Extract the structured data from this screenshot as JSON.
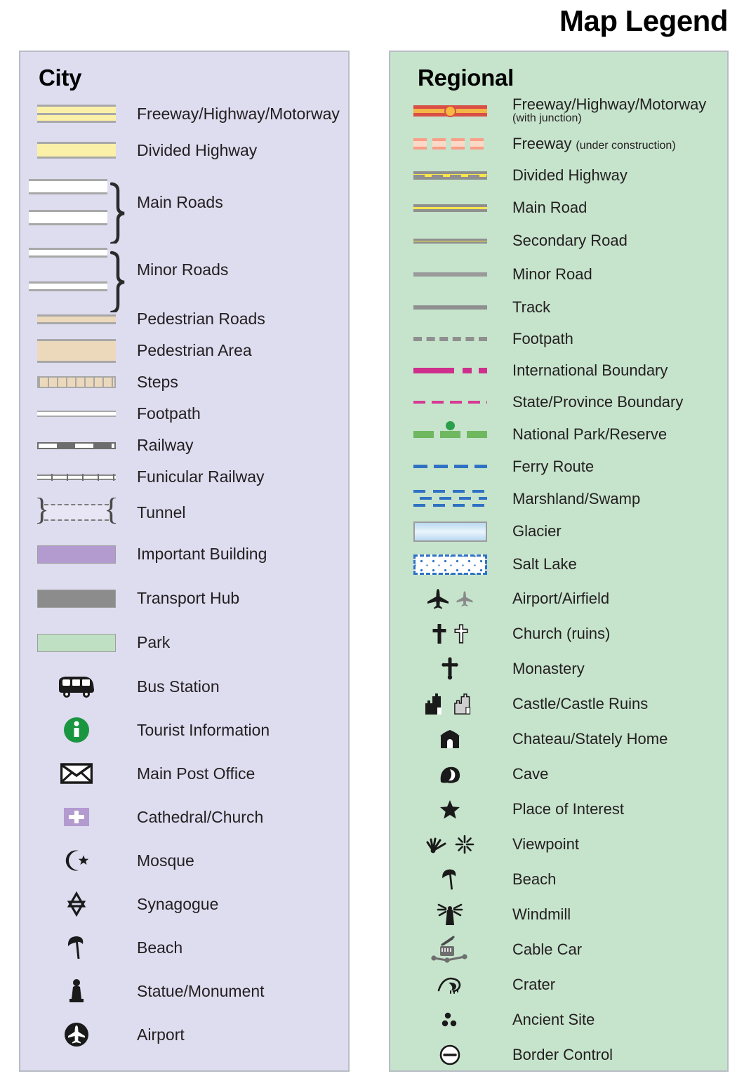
{
  "title": "Map Legend",
  "city": {
    "heading": "City",
    "items": [
      {
        "label": "Freeway/Highway/Motorway",
        "symbol": "freeway-band"
      },
      {
        "label": "Divided Highway",
        "symbol": "divided-highway-band"
      },
      {
        "label": "Main Roads",
        "symbol": "main-roads-bracket"
      },
      {
        "label": "Minor Roads",
        "symbol": "minor-roads-bracket"
      },
      {
        "label": "Pedestrian Roads",
        "symbol": "pedestrian-road-band"
      },
      {
        "label": "Pedestrian Area",
        "symbol": "pedestrian-area-block"
      },
      {
        "label": "Steps",
        "symbol": "steps-band"
      },
      {
        "label": "Footpath",
        "symbol": "footpath-band"
      },
      {
        "label": "Railway",
        "symbol": "railway-band"
      },
      {
        "label": "Funicular Railway",
        "symbol": "funicular-railway-band"
      },
      {
        "label": "Tunnel",
        "symbol": "tunnel-band"
      },
      {
        "label": "Important Building",
        "symbol": "important-building-block"
      },
      {
        "label": "Transport Hub",
        "symbol": "transport-hub-block"
      },
      {
        "label": "Park",
        "symbol": "park-block"
      },
      {
        "label": "Bus Station",
        "symbol": "bus-icon"
      },
      {
        "label": "Tourist Information",
        "symbol": "information-icon"
      },
      {
        "label": "Main Post Office",
        "symbol": "envelope-icon"
      },
      {
        "label": "Cathedral/Church",
        "symbol": "church-cross-icon"
      },
      {
        "label": "Mosque",
        "symbol": "crescent-star-icon"
      },
      {
        "label": "Synagogue",
        "symbol": "star-of-david-icon"
      },
      {
        "label": "Beach",
        "symbol": "beach-umbrella-icon"
      },
      {
        "label": "Statue/Monument",
        "symbol": "statue-icon"
      },
      {
        "label": "Airport",
        "symbol": "airplane-circle-icon"
      }
    ]
  },
  "regional": {
    "heading": "Regional",
    "items": [
      {
        "label": "Freeway/Highway/Motorway",
        "sublabel": "(with junction)",
        "symbol": "freeway-junction-line"
      },
      {
        "label": "Freeway",
        "sublabel": "(under construction)",
        "symbol": "freeway-under-construction-line"
      },
      {
        "label": "Divided Highway",
        "symbol": "divided-highway-line"
      },
      {
        "label": "Main Road",
        "symbol": "main-road-line"
      },
      {
        "label": "Secondary Road",
        "symbol": "secondary-road-line"
      },
      {
        "label": "Minor Road",
        "symbol": "minor-road-line"
      },
      {
        "label": "Track",
        "symbol": "track-line"
      },
      {
        "label": "Footpath",
        "symbol": "footpath-dashed-line"
      },
      {
        "label": "International Boundary",
        "symbol": "international-boundary-line"
      },
      {
        "label": "State/Province Boundary",
        "symbol": "state-boundary-line"
      },
      {
        "label": "National Park/Reserve",
        "symbol": "national-park-line"
      },
      {
        "label": "Ferry Route",
        "symbol": "ferry-route-line"
      },
      {
        "label": "Marshland/Swamp",
        "symbol": "marshland-pattern"
      },
      {
        "label": "Glacier",
        "symbol": "glacier-swatch"
      },
      {
        "label": "Salt Lake",
        "symbol": "salt-lake-swatch"
      },
      {
        "label": "Airport/Airfield",
        "symbol": "airplane-pair-icon"
      },
      {
        "label": "Church (ruins)",
        "symbol": "cross-pair-icon"
      },
      {
        "label": "Monastery",
        "symbol": "monastery-cross-icon"
      },
      {
        "label": "Castle/Castle Ruins",
        "symbol": "castle-pair-icon"
      },
      {
        "label": "Chateau/Stately Home",
        "symbol": "chateau-icon"
      },
      {
        "label": "Cave",
        "symbol": "cave-icon"
      },
      {
        "label": "Place of Interest",
        "symbol": "star-icon"
      },
      {
        "label": "Viewpoint",
        "symbol": "viewpoint-pair-icon"
      },
      {
        "label": "Beach",
        "symbol": "beach-umbrella-icon"
      },
      {
        "label": "Windmill",
        "symbol": "windmill-icon"
      },
      {
        "label": "Cable Car",
        "symbol": "cable-car-icon"
      },
      {
        "label": "Crater",
        "symbol": "crater-icon"
      },
      {
        "label": "Ancient Site",
        "symbol": "ancient-site-icon"
      },
      {
        "label": "Border Control",
        "symbol": "border-control-icon"
      }
    ]
  },
  "colors": {
    "city_panel_bg": "#dedcef",
    "regional_panel_bg": "#c6e3cc",
    "panel_border": "#b8bcc4",
    "highway_yellow": "#fbf0a8",
    "regional_road_yellow": "#fbe74a",
    "freeway_red": "#d94f45",
    "freeway_orange": "#f4b547",
    "pedestrian_tan": "#ecd9bc",
    "important_building_purple": "#b39bd0",
    "transport_hub_gray": "#8c8c8c",
    "park_green": "#bfe0c3",
    "boundary_magenta": "#cf2e8c",
    "park_line_green": "#6fb860",
    "water_blue": "#2f72c4",
    "info_green": "#1a9641",
    "text": "#231f20"
  }
}
